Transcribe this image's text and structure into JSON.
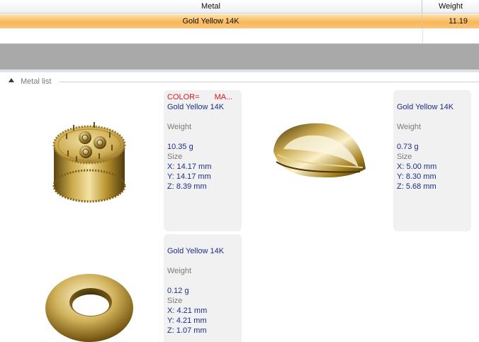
{
  "grid": {
    "columns": {
      "metal": "Metal",
      "weight": "Weight"
    },
    "rows": [
      {
        "metal": "Gold Yellow 14K",
        "weight": "11.19"
      }
    ]
  },
  "metal_list": {
    "title": "Metal list",
    "color_header": {
      "label": "COLOR=",
      "value": "MA..."
    },
    "items": [
      {
        "metal": "Gold Yellow 14K",
        "weight_label": "Weight",
        "weight": "10.35 g",
        "size_label": "Size",
        "x": "X: 14.17 mm",
        "y": "Y: 14.17 mm",
        "z": "Z: 8.39 mm"
      },
      {
        "metal": "Gold Yellow 14K",
        "weight_label": "Weight",
        "weight": "0.73 g",
        "size_label": "Size",
        "x": "X: 5.00 mm",
        "y": "Y: 8.30 mm",
        "z": "Z: 5.68 mm"
      },
      {
        "metal": "Gold Yellow 14K",
        "weight_label": "Weight",
        "weight": "0.12 g",
        "size_label": "Size",
        "x": "X: 4.21 mm",
        "y": "Y: 4.21 mm",
        "z": "Z: 1.07 mm"
      }
    ]
  }
}
